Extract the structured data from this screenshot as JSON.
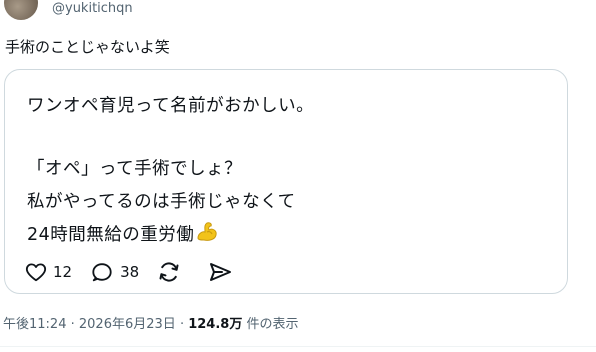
{
  "author": {
    "handle": "@yukitichqn"
  },
  "tweet": {
    "text": "手術のことじゃないよ笑"
  },
  "quote": {
    "lines": [
      "ワンオペ育児って名前がおかしい。",
      "「オペ」って手術でしょ？",
      "私がやってるのは手術じゃなくて",
      "24時間無給の重労働"
    ],
    "emoji": "flexed-biceps"
  },
  "actions": {
    "like_count": "12",
    "reply_count": "38",
    "icons": [
      "heart-icon",
      "reply-icon",
      "retweet-icon",
      "share-icon"
    ]
  },
  "meta": {
    "time": "午後11:24",
    "date": "2026年6月23日",
    "separator": "·",
    "views_count": "124.8万",
    "views_label": "件の表示"
  },
  "colors": {
    "text": "#0f1419",
    "secondary": "#536471",
    "border": "#cfd9de",
    "emoji": "#f2c31a"
  }
}
